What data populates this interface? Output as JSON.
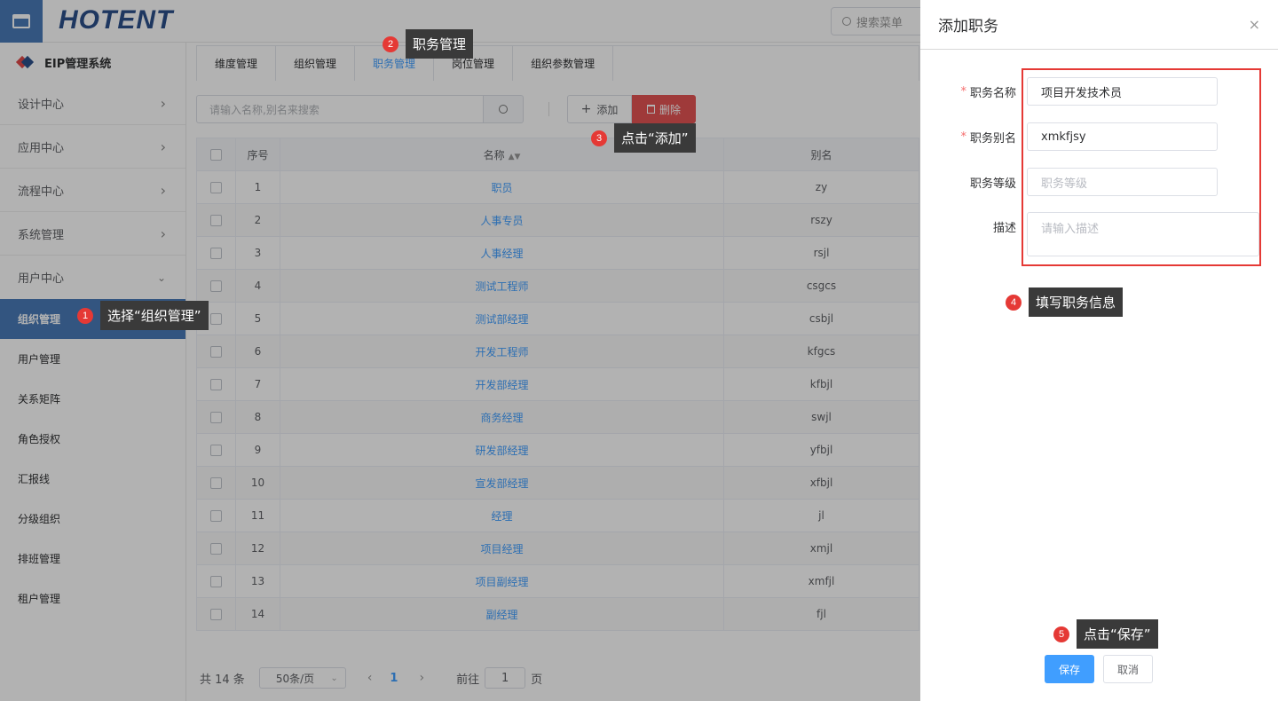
{
  "header": {
    "logo_text": "HOTENT",
    "search_placeholder": "搜索菜单"
  },
  "sidebar": {
    "system_title": "EIP管理系统",
    "groups": [
      {
        "label": "设计中心"
      },
      {
        "label": "应用中心"
      },
      {
        "label": "流程中心"
      },
      {
        "label": "系统管理"
      },
      {
        "label": "用户中心"
      }
    ],
    "items": [
      {
        "label": "组织管理"
      },
      {
        "label": "用户管理"
      },
      {
        "label": "关系矩阵"
      },
      {
        "label": "角色授权"
      },
      {
        "label": "汇报线"
      },
      {
        "label": "分级组织"
      },
      {
        "label": "排班管理"
      },
      {
        "label": "租户管理"
      }
    ]
  },
  "main": {
    "tabs": [
      {
        "label": "维度管理"
      },
      {
        "label": "组织管理"
      },
      {
        "label": "职务管理"
      },
      {
        "label": "岗位管理"
      },
      {
        "label": "组织参数管理"
      }
    ],
    "search_placeholder": "请输入名称,别名来搜索",
    "add_label": "添加",
    "delete_label": "删除",
    "table": {
      "headers": [
        "序号",
        "名称",
        "别名"
      ],
      "rows": [
        {
          "no": "1",
          "name": "职员",
          "alias": "zy"
        },
        {
          "no": "2",
          "name": "人事专员",
          "alias": "rszy"
        },
        {
          "no": "3",
          "name": "人事经理",
          "alias": "rsjl"
        },
        {
          "no": "4",
          "name": "测试工程师",
          "alias": "csgcs"
        },
        {
          "no": "5",
          "name": "测试部经理",
          "alias": "csbjl"
        },
        {
          "no": "6",
          "name": "开发工程师",
          "alias": "kfgcs"
        },
        {
          "no": "7",
          "name": "开发部经理",
          "alias": "kfbjl"
        },
        {
          "no": "8",
          "name": "商务经理",
          "alias": "swjl"
        },
        {
          "no": "9",
          "name": "研发部经理",
          "alias": "yfbjl"
        },
        {
          "no": "10",
          "name": "宣发部经理",
          "alias": "xfbjl"
        },
        {
          "no": "11",
          "name": "经理",
          "alias": "jl"
        },
        {
          "no": "12",
          "name": "项目经理",
          "alias": "xmjl"
        },
        {
          "no": "13",
          "name": "项目副经理",
          "alias": "xmfjl"
        },
        {
          "no": "14",
          "name": "副经理",
          "alias": "fjl"
        }
      ]
    },
    "pager": {
      "total": "共 14 条",
      "page_size": "50条/页",
      "current_page": "1",
      "goto_prefix": "前往",
      "goto_value": "1",
      "goto_suffix": "页"
    }
  },
  "drawer": {
    "title": "添加职务",
    "fields": {
      "name_label": "职务名称",
      "name_value": "项目开发技术员",
      "alias_label": "职务别名",
      "alias_value": "xmkfjsy",
      "level_label": "职务等级",
      "level_placeholder": "职务等级",
      "desc_label": "描述",
      "desc_placeholder": "请输入描述"
    },
    "save_label": "保存",
    "cancel_label": "取消"
  },
  "callouts": [
    {
      "num": "1",
      "text": "选择“组织管理”"
    },
    {
      "num": "2",
      "text": "职务管理"
    },
    {
      "num": "3",
      "text": "点击“添加”"
    },
    {
      "num": "4",
      "text": "填写职务信息"
    },
    {
      "num": "5",
      "text": "点击“保存”"
    }
  ],
  "colors": {
    "accent": "#409eff",
    "sidebar_active": "#4a7ab8",
    "danger": "#e45454",
    "highlight_box": "#e53935"
  }
}
